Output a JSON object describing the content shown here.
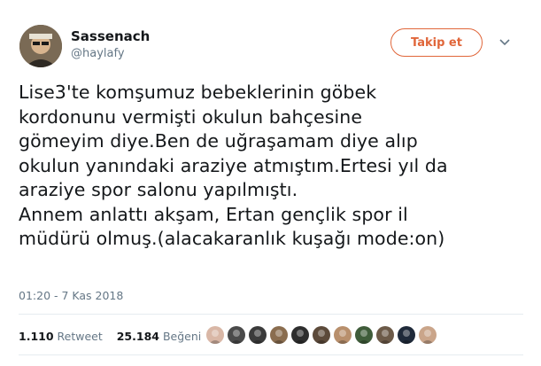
{
  "author": {
    "name": "Sassenach",
    "handle": "@haylafy"
  },
  "follow_button_label": "Takip et",
  "tweet_text": "Lise3'te komşumuz bebeklerinin göbek\nkordonunu vermişti okulun bahçesine\ngömeyim diye.Ben de uğraşamam diye alıp\nokulun yanındaki araziye atmıştım.Ertesi yıl da\naraziye spor salonu yapılmıştı.\nAnnem anlattı akşam, Ertan gençlik spor il\nmüdürü olmuş.(alacakaranlık kuşağı mode:on)",
  "timestamp": "01:20 - 7 Kas 2018",
  "stats": {
    "retweet_count": "1.110",
    "retweet_label": "Retweet",
    "like_count": "25.184",
    "like_label": "Beğeni"
  },
  "colors": {
    "accent": "#e0663a",
    "muted": "#657786",
    "text": "#14171a"
  },
  "liker_avatar_colors": [
    "#d9b7a6",
    "#4a4a4a",
    "#3b3b3b",
    "#8a6d4f",
    "#2e2e2e",
    "#5c4a3a",
    "#b88f6c",
    "#3f5c3a",
    "#6c5a48",
    "#1f2a3a",
    "#caa58a"
  ]
}
